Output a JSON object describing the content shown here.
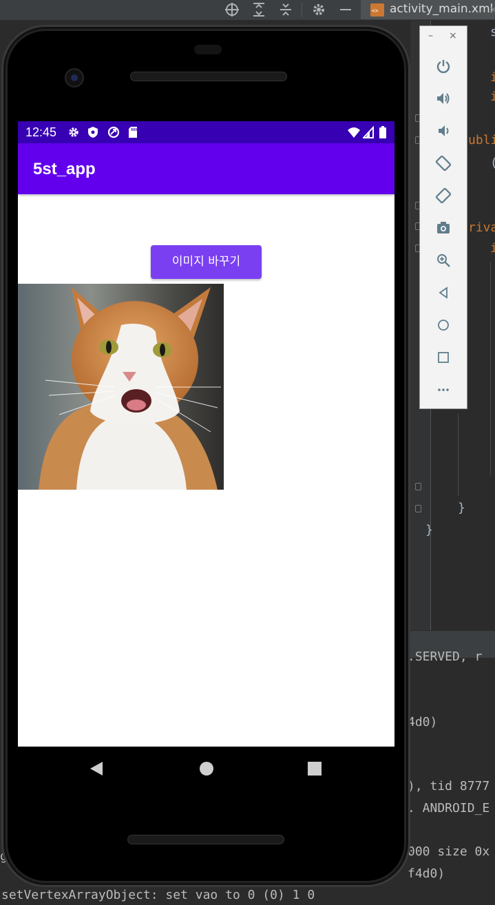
{
  "ide": {
    "tab_label": "activity_main.xml",
    "tab_close": "×",
    "code_lines": [
      "s",
      "i",
      "i",
      "ubli",
      "(",
      "riva",
      "i",
      "}",
      "}"
    ],
    "log_lines": [
      ".SERVED, r",
      "4d0)",
      "), tid 8777",
      ". ANDROID_E",
      "000 size 0x",
      "f4d0)",
      "gl",
      "setVertexArrayObject: set vao to 0 (0) 1 0"
    ]
  },
  "emulator": {
    "minimize": "–",
    "close": "×",
    "controls": [
      "power-icon",
      "volume-up-icon",
      "volume-down-icon",
      "rotate-left-icon",
      "rotate-right-icon",
      "camera-icon",
      "zoom-icon",
      "back-icon",
      "home-icon",
      "overview-icon",
      "more-icon"
    ]
  },
  "device": {
    "status_time": "12:45",
    "app_title": "5st_app",
    "change_image_button": "이미지 바꾸기",
    "image_alt": "orange and white cat"
  },
  "colors": {
    "status_bar": "#3700b3",
    "app_bar": "#6200ee",
    "button": "#7b3ff2"
  }
}
